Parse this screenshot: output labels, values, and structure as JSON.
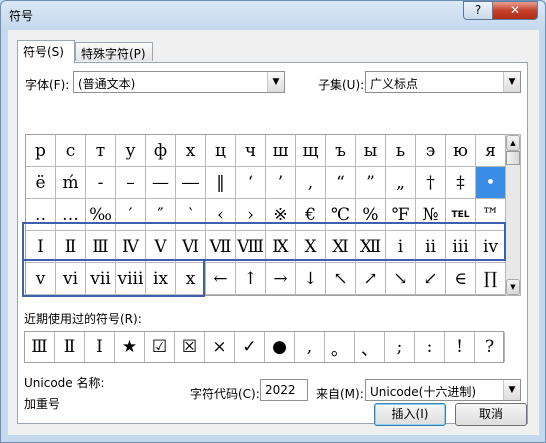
{
  "window": {
    "title": "符号",
    "help_label": "?",
    "close_label": "✕"
  },
  "tabs": [
    {
      "label": "符号(S)",
      "active": true
    },
    {
      "label": "特殊字符(P)",
      "active": false
    }
  ],
  "font": {
    "label": "字体(F):",
    "value": "(普通文本)"
  },
  "subset": {
    "label": "子集(U):",
    "value": "广义标点"
  },
  "symbol_grid": [
    [
      "р",
      "с",
      "т",
      "у",
      "ф",
      "х",
      "ц",
      "ч",
      "ш",
      "щ",
      "ъ",
      "ы",
      "ь",
      "э",
      "ю",
      "я"
    ],
    [
      "ё",
      "ḿ",
      "-",
      "–",
      "—",
      "―",
      "‖",
      "‘",
      "’",
      ",",
      "“",
      "”",
      "„",
      "†",
      "‡",
      "•"
    ],
    [
      "‥",
      "…",
      "‰",
      "′",
      "″",
      "‵",
      "‹",
      "›",
      "※",
      "€",
      "℃",
      "%",
      "℉",
      "№",
      "TEL",
      "™"
    ],
    [
      "Ⅰ",
      "Ⅱ",
      "Ⅲ",
      "Ⅳ",
      "Ⅴ",
      "Ⅵ",
      "Ⅶ",
      "Ⅷ",
      "Ⅸ",
      "Ⅹ",
      "Ⅺ",
      "Ⅻ",
      "ⅰ",
      "ⅱ",
      "ⅲ",
      "ⅳ"
    ],
    [
      "ⅴ",
      "ⅵ",
      "ⅶ",
      "ⅷ",
      "ⅸ",
      "ⅹ",
      "←",
      "↑",
      "→",
      "↓",
      "↖",
      "↗",
      "↘",
      "↙",
      "∈",
      "∏"
    ]
  ],
  "selected_cell": {
    "row": 1,
    "col": 15
  },
  "recent": {
    "label": "近期使用过的符号(R):",
    "symbols": [
      "Ⅲ",
      "Ⅱ",
      "Ⅰ",
      "★",
      "☑",
      "☒",
      "×",
      "✓",
      "●",
      ",",
      "。",
      "、",
      ";",
      ":",
      "!",
      "?"
    ]
  },
  "unicode_name": {
    "label": "Unicode 名称:",
    "value": "加重号"
  },
  "char_code": {
    "label": "字符代码(C):",
    "value": "2022"
  },
  "from": {
    "label": "来自(M):",
    "value": "Unicode(十六进制)"
  },
  "buttons": {
    "insert": "插入(I)",
    "cancel": "取消"
  },
  "colors": {
    "highlight_box": "#3d5fae",
    "selected_cell": "#3a8ee6"
  }
}
